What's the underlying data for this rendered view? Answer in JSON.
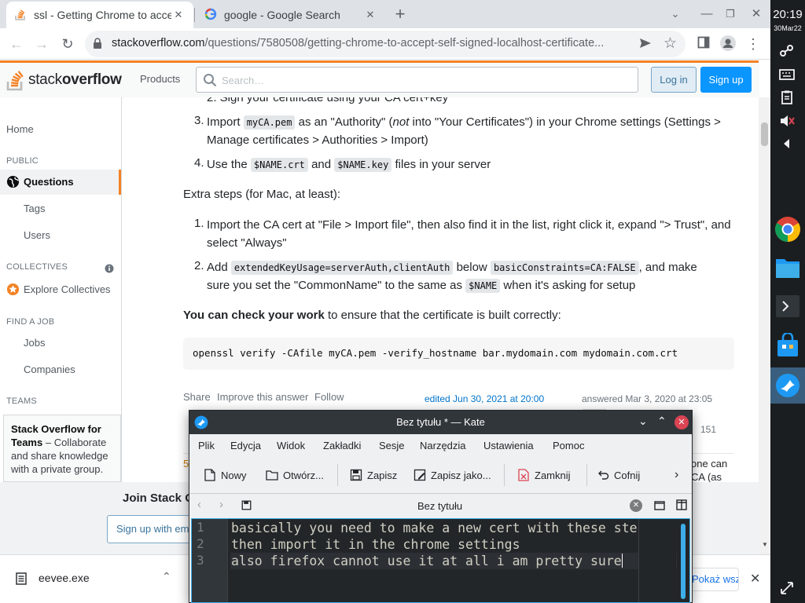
{
  "browser": {
    "tabs": [
      {
        "title": "ssl - Getting Chrome to accept self-signed localhost certificate",
        "active": true
      },
      {
        "title": "google - Google Search",
        "active": false
      }
    ],
    "url_domain": "stackoverflow.com",
    "url_path": "/questions/7580508/getting-chrome-to-accept-self-signed-localhost-certificate..."
  },
  "so": {
    "logo_text_a": "stack",
    "logo_text_b": "overflow",
    "products": "Products",
    "search_placeholder": "Search…",
    "login": "Log in",
    "signup": "Sign up"
  },
  "sidebar": {
    "home": "Home",
    "public": "PUBLIC",
    "questions": "Questions",
    "tags": "Tags",
    "users": "Users",
    "collectives": "COLLECTIVES",
    "explore_collectives": "Explore Collectives",
    "find_a_job": "FIND A JOB",
    "jobs": "Jobs",
    "companies": "Companies",
    "teams": "TEAMS",
    "teams_box_title": "Stack Overflow for Teams",
    "teams_box_text": " – Collaborate and share knowledge with a private group."
  },
  "answer": {
    "step2_cut": "2. Sign your certificate using your CA cert+key",
    "step3_pre": "Import ",
    "step3_code": "myCA.pem",
    "step3_mid": " as an \"Authority\" (",
    "step3_not": "not",
    "step3_post": " into \"Your Certificates\") in your Chrome settings (Settings >",
    "step3_line2": "Manage certificates > Authorities > Import)",
    "step4_pre": "Use the ",
    "step4_code1": "$NAME.crt",
    "step4_mid": " and ",
    "step4_code2": "$NAME.key",
    "step4_post": " files in your server",
    "extra_steps": "Extra steps (for Mac, at least):",
    "mac1_line1": "Import the CA cert at \"File > Import file\", then also find it in the list, right click it, expand \"> Trust\", and",
    "mac1_line2": "select \"Always\"",
    "mac2_pre": "Add ",
    "mac2_code1": "extendedKeyUsage=serverAuth,clientAuth",
    "mac2_mid": " below ",
    "mac2_code2": "basicConstraints=CA:FALSE",
    "mac2_post": ", and make",
    "mac2_line2_pre": "sure you set the \"CommonName\" to the same as ",
    "mac2_code3": "$NAME",
    "mac2_line2_post": " when it's asking for setup",
    "check_bold": "You can check your work",
    "check_rest": " to ensure that the certificate is built correctly:",
    "code_block": "openssl verify -CAfile myCA.pem -verify_hostname bar.mydomain.com mydomain.com.crt",
    "share": "Share",
    "improve": "Improve this answer",
    "follow": "Follow",
    "edited": "edited Jun 30, 2021 at 20:00",
    "answered": "answered Mar 3, 2020 at 23:05",
    "rep": "151",
    "peek_right1": "one can",
    "peek_right2": "CA (as",
    "peek_left": "5"
  },
  "banner": {
    "join_title": "Join Stack Overflow to learn, share knowledge, and build your career.",
    "join_btn": "Sign up with email"
  },
  "downloads": {
    "file": "eevee.exe",
    "show_all": "Pokaż wszystkie"
  },
  "taskbar": {
    "time": "20:19",
    "date": "30Mar22"
  },
  "kate": {
    "title": "Bez tytułu * — Kate",
    "menu": [
      "Plik",
      "Edycja",
      "Widok",
      "Zakładki",
      "Sesje",
      "Narzędzia",
      "Ustawienia",
      "Pomoc"
    ],
    "tools": {
      "new": "Nowy",
      "open": "Otwórz...",
      "save": "Zapisz",
      "save_as": "Zapisz jako...",
      "close": "Zamknij",
      "undo": "Cofnij"
    },
    "doc_tab": "Bez tytułu",
    "lines": [
      "basically you need to make a new cert with these steps",
      "then import it in the chrome settings",
      "also firefox cannot use it at all i am pretty sure"
    ],
    "line_numbers": [
      "1",
      "2",
      "3"
    ]
  },
  "colors": {
    "so_orange": "#f48225",
    "so_blue": "#0a95ff",
    "kate_bg": "#232629",
    "breeze_highlight": "#3daee9"
  }
}
